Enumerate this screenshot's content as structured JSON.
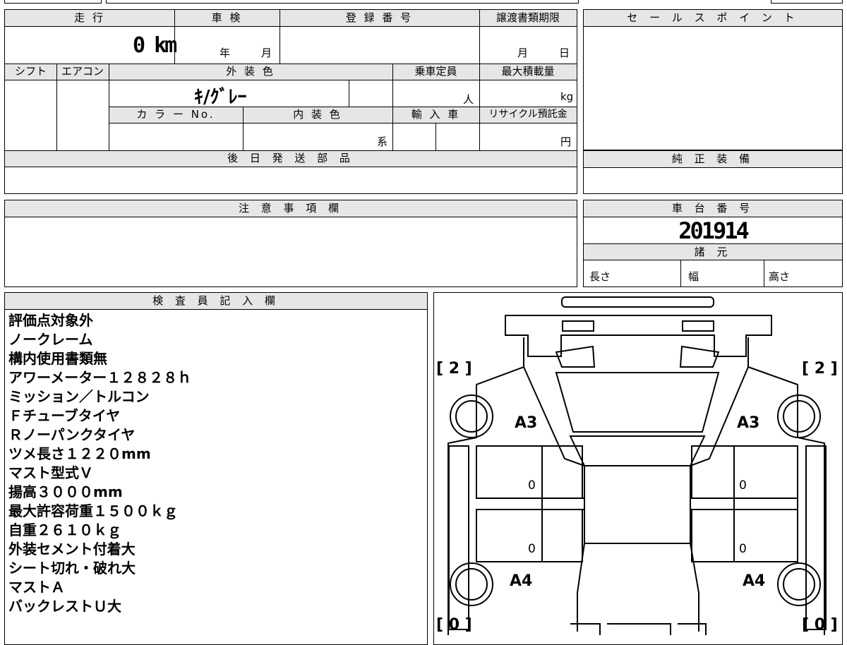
{
  "top": {
    "mileage_label": "走 行",
    "mileage_value": "0 km",
    "inspection_label": "車 検",
    "inspection_year": "年",
    "inspection_month": "月",
    "registration_label": "登 録 番 号",
    "transfer_label": "譲渡書類期限",
    "transfer_month": "月",
    "transfer_day": "日",
    "shift_label": "シフト",
    "ac_label": "エアコン",
    "exterior_color_label": "外 装 色",
    "exterior_color_value": "ｷ/ｸﾞﾚｰ",
    "capacity_label": "乗車定員",
    "capacity_unit": "人",
    "max_load_label": "最大積載量",
    "max_load_unit": "kg",
    "color_no_label": "カ ラ ー No.",
    "interior_color_label": "内 装 色",
    "interior_color_unit": "系",
    "import_label": "輸 入 車",
    "recycle_label": "リサイクル預託金",
    "recycle_unit": "円",
    "later_parts_label": "後 日 発 送 部 品",
    "notes_label": "注 意 事 項 欄"
  },
  "right": {
    "sales_point_label": "セ ー ル ス ポ イ ン ト",
    "genuine_equipment_label": "純 正 装 備",
    "chassis_label": "車 台 番 号",
    "chassis_value": "201914",
    "specs_label": "諸 元",
    "length_label": "長さ",
    "width_label": "幅",
    "height_label": "高さ"
  },
  "inspector": {
    "header": "検 査 員 記 入 欄",
    "lines": [
      "評価点対象外",
      "ノークレーム",
      "構内使用書類無",
      "アワーメーター１２８２８ｈ",
      "ミッション／トルコン",
      "Ｆチューブタイヤ",
      "Ｒノーパンクタイヤ",
      "ツメ長さ１２２０mm",
      "マスト型式Ｖ",
      "揚高３０００mm",
      "最大許容荷重１５００ｋｇ",
      "自重２６１０ｋｇ",
      "外装セメント付着大",
      "シート切れ・破れ大",
      "マストＡ",
      "バックレストＵ大"
    ]
  },
  "diagram": {
    "front_left_count": "[ 2 ]",
    "front_right_count": "[ 2 ]",
    "rear_left_count": "[ 0 ]",
    "rear_right_count": "[ 0 ]",
    "front_left_mark": "A3",
    "front_right_mark": "A3",
    "rear_left_mark": "A4",
    "rear_right_mark": "A4",
    "door_fl": "0",
    "door_fr": "0",
    "door_rl": "0",
    "door_rr": "0"
  }
}
